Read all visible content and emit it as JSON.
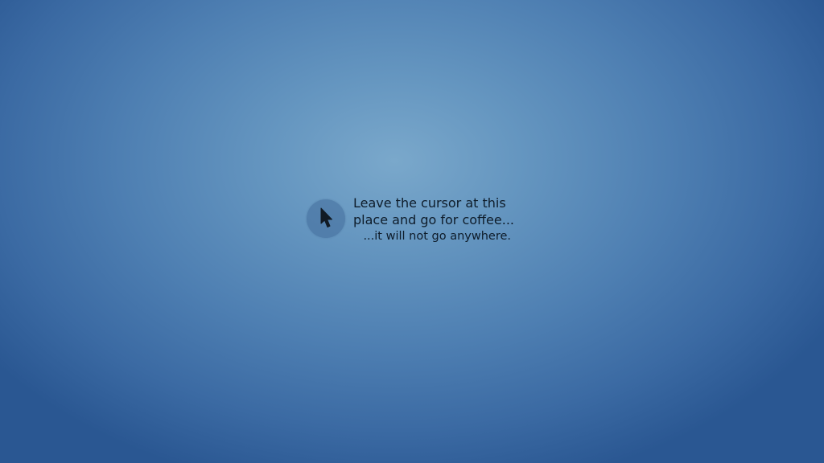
{
  "wallpaper": {
    "colors": {
      "center": "#7aa8cb",
      "edge": "#23508d",
      "text": "#0e1c2a",
      "ring": "#3a6292"
    },
    "icon": "cursor-arrow-icon",
    "message": {
      "line1": "Leave the cursor at this",
      "line2": "place and go for coffee...",
      "line3": "...it will not go anywhere."
    }
  }
}
